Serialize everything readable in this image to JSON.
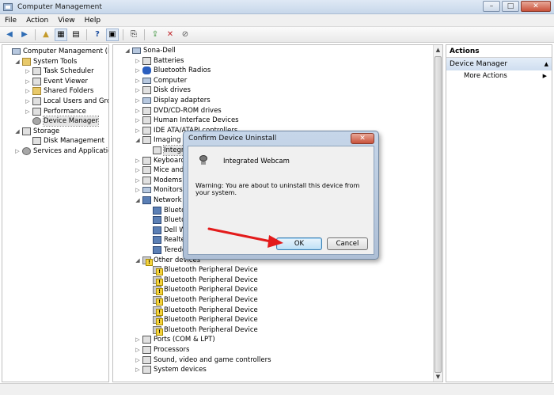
{
  "window": {
    "title": "Computer Management",
    "min": "–",
    "max": "□",
    "close": "✕"
  },
  "menu": [
    "File",
    "Action",
    "View",
    "Help"
  ],
  "tree_left": [
    {
      "label": "Computer Management (Local",
      "indent": 0,
      "icon": "computer-icon",
      "tw": ""
    },
    {
      "label": "System Tools",
      "indent": 1,
      "icon": "tools-icon",
      "tw": "◢"
    },
    {
      "label": "Task Scheduler",
      "indent": 2,
      "icon": "clock-icon",
      "tw": "▷"
    },
    {
      "label": "Event Viewer",
      "indent": 2,
      "icon": "event-icon",
      "tw": "▷"
    },
    {
      "label": "Shared Folders",
      "indent": 2,
      "icon": "folder-icon",
      "tw": "▷"
    },
    {
      "label": "Local Users and Groups",
      "indent": 2,
      "icon": "users-icon",
      "tw": "▷"
    },
    {
      "label": "Performance",
      "indent": 2,
      "icon": "performance-icon",
      "tw": "▷"
    },
    {
      "label": "Device Manager",
      "indent": 2,
      "icon": "device-manager-icon",
      "tw": "",
      "selected": true
    },
    {
      "label": "Storage",
      "indent": 1,
      "icon": "storage-icon",
      "tw": "◢"
    },
    {
      "label": "Disk Management",
      "indent": 2,
      "icon": "disk-icon",
      "tw": ""
    },
    {
      "label": "Services and Applications",
      "indent": 1,
      "icon": "services-icon",
      "tw": "▷"
    }
  ],
  "tree_mid": [
    {
      "label": "Sona-Dell",
      "indent": 0,
      "icon": "computer-icon",
      "tw": "◢"
    },
    {
      "label": "Batteries",
      "indent": 1,
      "icon": "battery-icon",
      "tw": "▷"
    },
    {
      "label": "Bluetooth Radios",
      "indent": 1,
      "icon": "bluetooth-icon",
      "tw": "▷"
    },
    {
      "label": "Computer",
      "indent": 1,
      "icon": "computer-icon",
      "tw": "▷"
    },
    {
      "label": "Disk drives",
      "indent": 1,
      "icon": "disk-icon",
      "tw": "▷"
    },
    {
      "label": "Display adapters",
      "indent": 1,
      "icon": "display-icon",
      "tw": "▷"
    },
    {
      "label": "DVD/CD-ROM drives",
      "indent": 1,
      "icon": "dvd-icon",
      "tw": "▷"
    },
    {
      "label": "Human Interface Devices",
      "indent": 1,
      "icon": "hid-icon",
      "tw": "▷"
    },
    {
      "label": "IDE ATA/ATAPI controllers",
      "indent": 1,
      "icon": "ide-icon",
      "tw": "▷"
    },
    {
      "label": "Imaging dev",
      "indent": 1,
      "icon": "camera-icon",
      "tw": "◢"
    },
    {
      "label": "Integrate",
      "indent": 2,
      "icon": "webcam-icon",
      "tw": "",
      "selected": true
    },
    {
      "label": "Keyboards",
      "indent": 1,
      "icon": "keyboard-icon",
      "tw": "▷"
    },
    {
      "label": "Mice and oth",
      "indent": 1,
      "icon": "mouse-icon",
      "tw": "▷"
    },
    {
      "label": "Modems",
      "indent": 1,
      "icon": "modem-icon",
      "tw": "▷"
    },
    {
      "label": "Monitors",
      "indent": 1,
      "icon": "monitor-icon",
      "tw": "▷"
    },
    {
      "label": "Network ada",
      "indent": 1,
      "icon": "network-icon",
      "tw": "◢"
    },
    {
      "label": "Bluetoo",
      "indent": 2,
      "icon": "network-icon",
      "tw": ""
    },
    {
      "label": "Bluetoo",
      "indent": 2,
      "icon": "network-icon",
      "tw": ""
    },
    {
      "label": "Dell Wire",
      "indent": 2,
      "icon": "network-icon",
      "tw": ""
    },
    {
      "label": "Realtek P",
      "indent": 2,
      "icon": "network-icon",
      "tw": ""
    },
    {
      "label": "Teredo T",
      "indent": 2,
      "icon": "network-icon",
      "tw": ""
    },
    {
      "label": "Other devices",
      "indent": 1,
      "icon": "warning-device-icon",
      "tw": "◢"
    },
    {
      "label": "Bluetooth Peripheral Device",
      "indent": 2,
      "icon": "warning-device-icon",
      "tw": ""
    },
    {
      "label": "Bluetooth Peripheral Device",
      "indent": 2,
      "icon": "warning-device-icon",
      "tw": ""
    },
    {
      "label": "Bluetooth Peripheral Device",
      "indent": 2,
      "icon": "warning-device-icon",
      "tw": ""
    },
    {
      "label": "Bluetooth Peripheral Device",
      "indent": 2,
      "icon": "warning-device-icon",
      "tw": ""
    },
    {
      "label": "Bluetooth Peripheral Device",
      "indent": 2,
      "icon": "warning-device-icon",
      "tw": ""
    },
    {
      "label": "Bluetooth Peripheral Device",
      "indent": 2,
      "icon": "warning-device-icon",
      "tw": ""
    },
    {
      "label": "Bluetooth Peripheral Device",
      "indent": 2,
      "icon": "warning-device-icon",
      "tw": ""
    },
    {
      "label": "Ports (COM & LPT)",
      "indent": 1,
      "icon": "port-icon",
      "tw": "▷"
    },
    {
      "label": "Processors",
      "indent": 1,
      "icon": "processor-icon",
      "tw": "▷"
    },
    {
      "label": "Sound, video and game controllers",
      "indent": 1,
      "icon": "sound-icon",
      "tw": "▷"
    },
    {
      "label": "System devices",
      "indent": 1,
      "icon": "system-icon",
      "tw": "▷"
    }
  ],
  "actions": {
    "header": "Actions",
    "section": "Device Manager",
    "more": "More Actions"
  },
  "dialog": {
    "title": "Confirm Device Uninstall",
    "device": "Integrated Webcam",
    "warning": "Warning: You are about to uninstall this device from your system.",
    "ok": "OK",
    "cancel": "Cancel",
    "close": "✕"
  }
}
